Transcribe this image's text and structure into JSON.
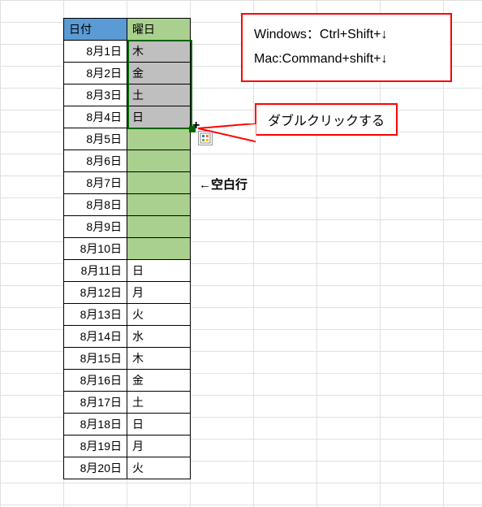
{
  "header": {
    "date": "日付",
    "day": "曜日"
  },
  "rows": [
    {
      "date": "8月1日",
      "day": "木",
      "gray": true
    },
    {
      "date": "8月2日",
      "day": "金",
      "gray": true
    },
    {
      "date": "8月3日",
      "day": "土",
      "gray": true
    },
    {
      "date": "8月4日",
      "day": "日",
      "gray": true
    },
    {
      "date": "8月5日",
      "day": "",
      "green": true
    },
    {
      "date": "8月6日",
      "day": "",
      "green": true
    },
    {
      "date": "8月7日",
      "day": "",
      "green": true
    },
    {
      "date": "8月8日",
      "day": "",
      "green": true
    },
    {
      "date": "8月9日",
      "day": "",
      "green": true
    },
    {
      "date": "8月10日",
      "day": "",
      "green": true
    },
    {
      "date": "8月11日",
      "day": "日"
    },
    {
      "date": "8月12日",
      "day": "月"
    },
    {
      "date": "8月13日",
      "day": "火"
    },
    {
      "date": "8月14日",
      "day": "水"
    },
    {
      "date": "8月15日",
      "day": "木"
    },
    {
      "date": "8月16日",
      "day": "金"
    },
    {
      "date": "8月17日",
      "day": "土"
    },
    {
      "date": "8月18日",
      "day": "日"
    },
    {
      "date": "8月19日",
      "day": "月"
    },
    {
      "date": "8月20日",
      "day": "火"
    }
  ],
  "info": {
    "line1": "Windows：Ctrl+Shift+↓",
    "line2": "Mac:Command+shift+↓"
  },
  "callout": {
    "text": "ダブルクリックする"
  },
  "note": {
    "text": "←空白行"
  }
}
